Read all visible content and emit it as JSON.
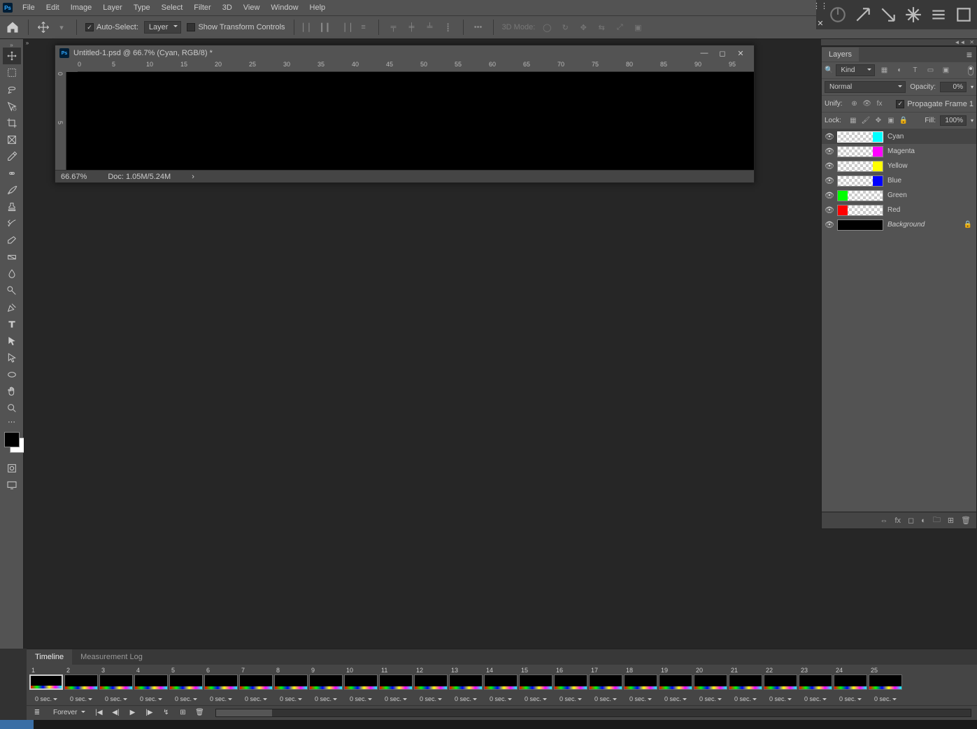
{
  "menu": [
    "File",
    "Edit",
    "Image",
    "Layer",
    "Type",
    "Select",
    "Filter",
    "3D",
    "View",
    "Window",
    "Help"
  ],
  "options": {
    "autoselect": "Auto-Select:",
    "layer": "Layer",
    "showtransform": "Show Transform Controls",
    "model3d": "3D Mode:"
  },
  "doc": {
    "title": "Untitled-1.psd @ 66.7% (Cyan, RGB/8) *",
    "zoom": "66.67%",
    "docsize": "Doc: 1.05M/5.24M",
    "rulerH": [
      "0",
      "5",
      "10",
      "15",
      "20",
      "25",
      "30",
      "35",
      "40",
      "45",
      "50",
      "55",
      "60",
      "65",
      "70",
      "75",
      "80",
      "85",
      "90",
      "95"
    ],
    "rulerV": [
      "0",
      "5"
    ]
  },
  "layers_panel": {
    "tab": "Layers",
    "kind": "Kind",
    "blend": "Normal",
    "opacity_lbl": "Opacity:",
    "opacity": "0%",
    "unify": "Unify:",
    "propagate": "Propagate Frame 1",
    "lock": "Lock:",
    "fill_lbl": "Fill:",
    "fill": "100%",
    "layers": [
      {
        "name": "Cyan",
        "c": "#00ffff",
        "sel": true,
        "side": "right"
      },
      {
        "name": "Magenta",
        "c": "#ff00ff",
        "side": "right"
      },
      {
        "name": "Yellow",
        "c": "#ffff00",
        "side": "right"
      },
      {
        "name": "Blue",
        "c": "#0000ff",
        "side": "right"
      },
      {
        "name": "Green",
        "c": "#00ff00",
        "side": "left"
      },
      {
        "name": "Red",
        "c": "#ff0000",
        "side": "left"
      },
      {
        "name": "Background",
        "bg": true
      }
    ]
  },
  "timeline": {
    "tab1": "Timeline",
    "tab2": "Measurement Log",
    "frames": 25,
    "delay": "0 sec.",
    "loop": "Forever"
  }
}
